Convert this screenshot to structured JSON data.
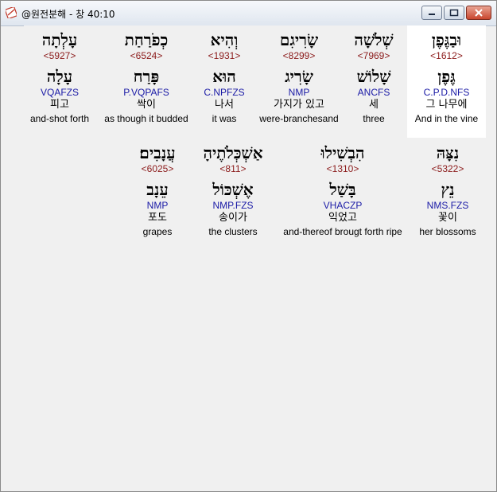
{
  "window": {
    "title": "@원전분해 - 창 40:10",
    "icon": "app-logo-icon"
  },
  "rows": [
    [
      {
        "hebrew": "וּבַגֶּפֶן",
        "strong": "<1612>",
        "root": "גֶּפֶן",
        "parse": "C.P.D.NFS",
        "korean": "그 나무에",
        "english": "And in the vine",
        "selected": true
      },
      {
        "hebrew": "שְׁלֹשָׁה",
        "strong": "<7969>",
        "root": "שָׁלוֹשׁ",
        "parse": "ANCFS",
        "korean": "세",
        "english": "three",
        "selected": false
      },
      {
        "hebrew": "שָׂרִיגִם",
        "strong": "<8299>",
        "root": "שָׂרִיג",
        "parse": "NMP",
        "korean": "가지가 있고",
        "english": "were-branchesand",
        "selected": false
      },
      {
        "hebrew": "וְהִיא",
        "strong": "<1931>",
        "root": "הוּא",
        "parse": "C.NPFZS",
        "korean": "나서",
        "english": "it was",
        "selected": false
      },
      {
        "hebrew": "כְפֹרַחַת",
        "strong": "<6524>",
        "root": "פָּרַח",
        "parse": "P.VQPAFS",
        "korean": "싹이",
        "english": "as though it budded",
        "selected": false
      },
      {
        "hebrew": "עָלְתָה",
        "strong": "<5927>",
        "root": "עָלָה",
        "parse": "VQAFZS",
        "korean": "피고",
        "english": "and-shot forth",
        "selected": false
      }
    ],
    [
      {
        "hebrew": "נִצָּהּ",
        "strong": "<5322>",
        "root": "נֵץ",
        "parse": "NMS.FZS",
        "korean": "꽃이",
        "english": "her blossoms",
        "selected": false
      },
      {
        "hebrew": "הִבְשִׁילוּ",
        "strong": "<1310>",
        "root": "בָּשַׁל",
        "parse": "VHACZP",
        "korean": "익었고",
        "english": "and-thereof brougt forth ripe",
        "selected": false
      },
      {
        "hebrew": "אַשְׁכְּלֹתֶיהָ",
        "strong": "<811>",
        "root": "אֶשְׁכּוֹל",
        "parse": "NMP.FZS",
        "korean": "송이가",
        "english": "the clusters",
        "selected": false
      },
      {
        "hebrew": "עֲנָבִים׃",
        "strong": "<6025>",
        "root": "עֵנָב",
        "parse": "NMP",
        "korean": "포도",
        "english": "grapes",
        "selected": false
      }
    ]
  ]
}
